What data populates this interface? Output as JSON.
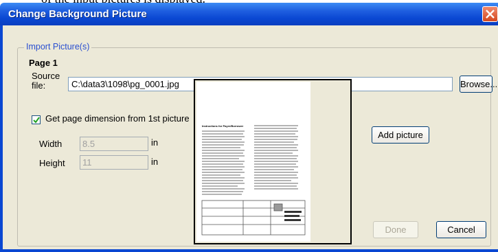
{
  "window": {
    "title": "Change Background Picture"
  },
  "group": {
    "legend": "Import Picture(s)",
    "page_label": "Page 1"
  },
  "source": {
    "label": "Source file:",
    "value": "C:\\data3\\1098\\pg_0001.jpg",
    "browse_label": "Browse..."
  },
  "dimension": {
    "checkbox_label": "Get page dimension from 1st picture",
    "checked": true,
    "width_label": "Width",
    "width_value": "8.5",
    "height_label": "Height",
    "height_value": "11",
    "unit": "in"
  },
  "actions": {
    "add_picture": "Add picture",
    "done": "Done",
    "cancel": "Cancel"
  },
  "preview": {
    "heading": "Instructions for Payer/Borrower"
  },
  "icons": {
    "close": "close-icon",
    "check": "checkmark-icon"
  },
  "colors": {
    "titlebar": "#0a47d2",
    "dialog_bg": "#ece9d8",
    "legend_text": "#2a4fd0",
    "close_button": "#d5471e"
  }
}
